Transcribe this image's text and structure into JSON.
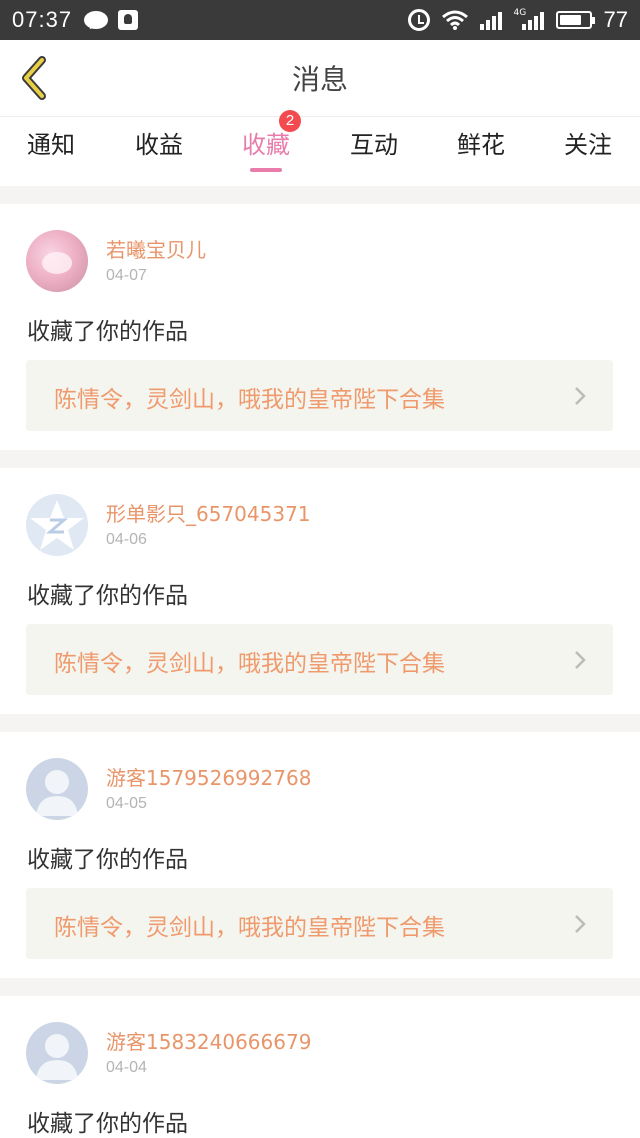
{
  "status_bar": {
    "time": "07:37",
    "network_tag": "4G",
    "battery": "77"
  },
  "header": {
    "title": "消息"
  },
  "tabs": [
    {
      "label": "通知"
    },
    {
      "label": "收益"
    },
    {
      "label": "收藏",
      "badge": "2",
      "active": true
    },
    {
      "label": "互动"
    },
    {
      "label": "鲜花"
    },
    {
      "label": "关注"
    }
  ],
  "messages": [
    {
      "name": "若曦宝贝儿",
      "date": "04-07",
      "action": "收藏了你的作品",
      "work": "陈情令，灵剑山，哦我的皇帝陛下合集",
      "avatar": "pink-photo-avatar"
    },
    {
      "name": "形单影只_657045371",
      "date": "04-06",
      "action": "收藏了你的作品",
      "work": "陈情令，灵剑山，哦我的皇帝陛下合集",
      "avatar": "qq-default-avatar"
    },
    {
      "name": "游客1579526992768",
      "date": "04-05",
      "action": "收藏了你的作品",
      "work": "陈情令，灵剑山，哦我的皇帝陛下合集",
      "avatar": "default-user-avatar"
    },
    {
      "name": "游客1583240666679",
      "date": "04-04",
      "action": "收藏了你的作品",
      "work": "",
      "avatar": "default-user-avatar"
    }
  ],
  "colors": {
    "accent": "#e87cab",
    "username": "#e8956a",
    "work_title": "#ef9a6c",
    "badge": "#f24a4f",
    "back_arrow": "#e7cf46"
  }
}
